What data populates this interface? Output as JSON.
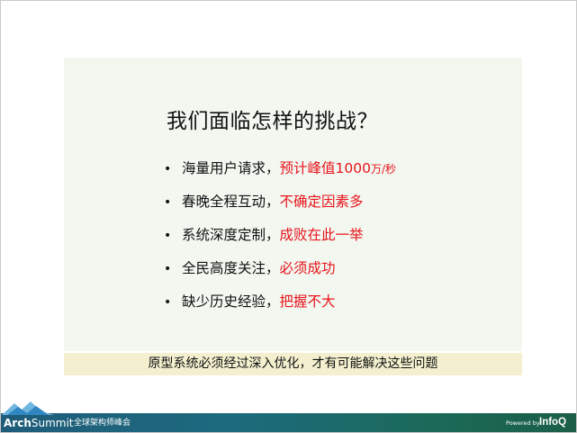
{
  "slide": {
    "title": "我们面临怎样的挑战？",
    "bullet_symbol": "•",
    "bullets": [
      {
        "text": "海量用户请求，",
        "highlight": "预计峰值1000",
        "unit": "万/秒"
      },
      {
        "text": "春晚全程互动，",
        "highlight": "不确定因素多",
        "unit": ""
      },
      {
        "text": "系统深度定制，",
        "highlight": "成败在此一举",
        "unit": ""
      },
      {
        "text": "全民高度关注，",
        "highlight": "必须成功",
        "unit": ""
      },
      {
        "text": "缺少历史经验，",
        "highlight": "把握不大",
        "unit": ""
      }
    ],
    "banner": "原型系统必须经过深入优化，才有可能解决这些问题"
  },
  "footer": {
    "brand_bold": "Arch",
    "brand_thin": "Summit",
    "brand_sub": "全球架构师峰会",
    "powered": "Powered by",
    "partner": "InfoQ"
  },
  "colors": {
    "highlight": "#e8141c",
    "panel_bg": "#f2f7f0",
    "banner_bg": "#f4f0cf",
    "footer_start": "#1e5c7a",
    "footer_end": "#1b5e47"
  },
  "icons": {
    "footer_logo": "mountain-logo-icon"
  }
}
